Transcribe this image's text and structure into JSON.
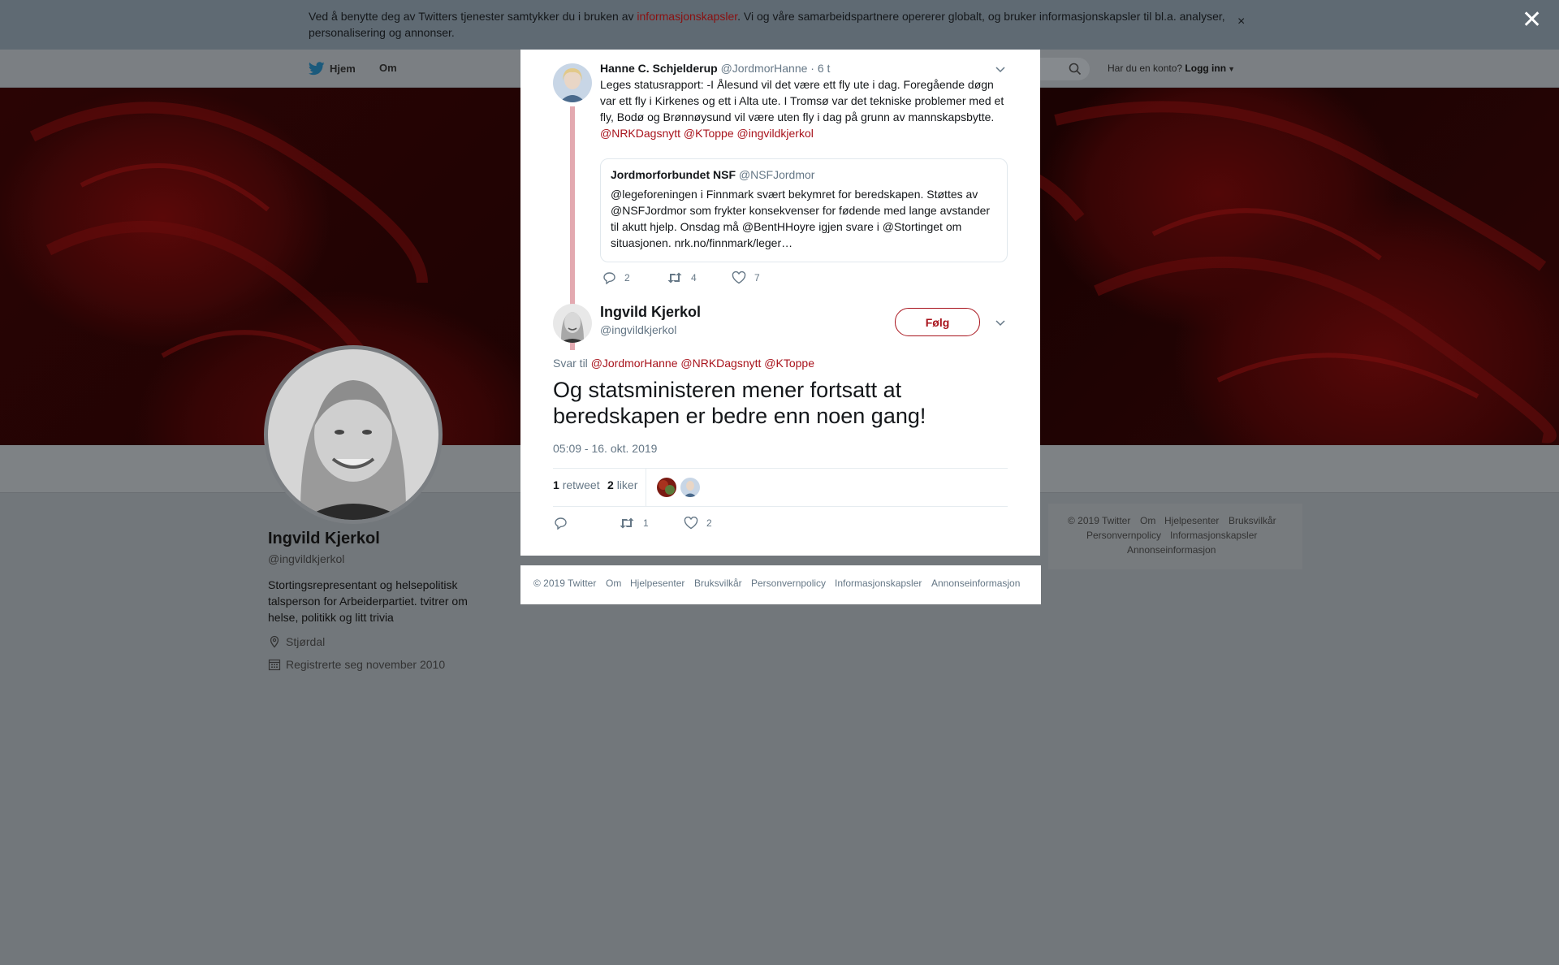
{
  "cookie_banner": {
    "text_before": "Ved å benytte deg av Twitters tjenester samtykker du i bruken av ",
    "link": "informasjonskapsler",
    "text_after": ". Vi og våre samarbeidspartnere opererer globalt, og bruker informasjonskapsler til bl.a. analyser, personalisering og annonser.",
    "close": "×"
  },
  "overlay_close": "✕",
  "nav": {
    "home": "Hjem",
    "about": "Om",
    "account_question": "Har du en konto?",
    "login": "Logg inn"
  },
  "profile": {
    "name": "Ingvild Kjerkol",
    "handle": "@ingvildkjerkol",
    "bio": "Stortingsrepresentant og helsepolitisk talsperson for Arbeiderpartiet. tvitrer om helse, politikk og litt trivia",
    "location": "Stjørdal",
    "joined": "Registrerte seg november 2010"
  },
  "side_footer": {
    "links": [
      "© 2019 Twitter",
      "Om",
      "Hjelpesenter",
      "Bruksvilkår",
      "Personvernpolicy",
      "Informasjonskapsler",
      "Annonseinformasjon"
    ]
  },
  "parent_tweet": {
    "name": "Hanne C. Schjelderup",
    "handle": "@JordmorHanne",
    "time": "· 6 t",
    "text": "Leges statusrapport: -I Ålesund vil det være ett fly ute i dag. Foregående døgn var ett fly i Kirkenes og ett i Alta ute. I Tromsø var det tekniske problemer med et fly, Bodø og Brønnøysund vil være uten fly i dag på grunn av mannskapsbytte.",
    "mentions": "@NRKDagsnytt @KToppe @ingvildkjerkol",
    "quote": {
      "name": "Jordmorforbundet NSF",
      "handle": "@NSFJordmor",
      "text": "@legeforeningen i Finnmark svært bekymret for beredskapen. Støttes av @NSFJordmor som frykter konsekvenser for fødende med lange avstander til akutt hjelp. Onsdag må @BentHHoyre igjen svare i @Stortinget om situasjonen. nrk.no/finnmark/leger…"
    },
    "replies": "2",
    "retweets": "4",
    "likes": "7"
  },
  "main_tweet": {
    "name": "Ingvild Kjerkol",
    "handle": "@ingvildkjerkol",
    "follow": "Følg",
    "reply_to_label": "Svar til",
    "reply_to": "@JordmorHanne @NRKDagsnytt @KToppe",
    "text": "Og statsministeren mener fortsatt at beredskapen er bedre enn noen gang!",
    "timestamp": "05:09 - 16. okt. 2019",
    "retweet_count": "1",
    "retweet_label": "retweet",
    "like_count": "2",
    "like_label": "liker",
    "action_retweets": "1",
    "action_likes": "2"
  },
  "modal_footer": {
    "links": [
      "© 2019 Twitter",
      "Om",
      "Hjelpesenter",
      "Bruksvilkår",
      "Personvernpolicy",
      "Informasjonskapsler",
      "Annonseinformasjon"
    ]
  },
  "colors": {
    "link_red": "#a8131c",
    "overlay": "#72777b",
    "muted": "#657786"
  }
}
